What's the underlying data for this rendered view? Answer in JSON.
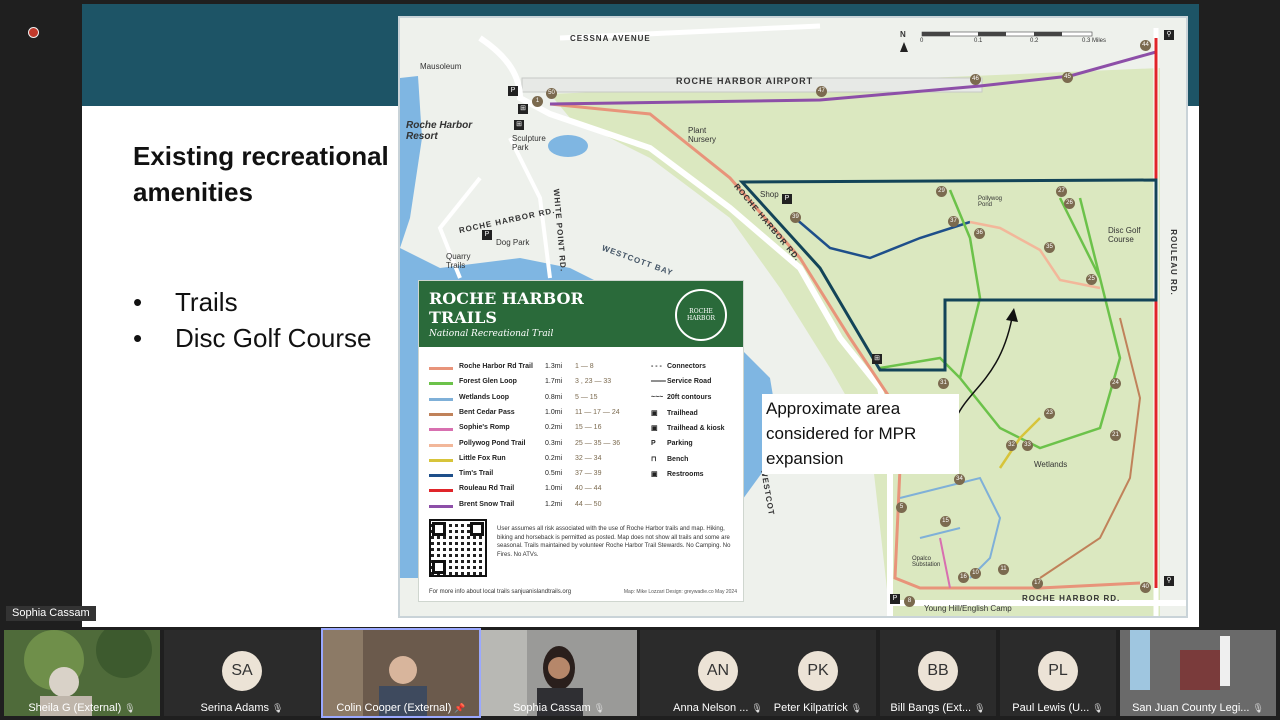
{
  "slide": {
    "title": "Existing recreational amenities",
    "bullets": [
      "Trails",
      "Disc Golf Course"
    ]
  },
  "map": {
    "labels": {
      "cessna": "CESSNA AVENUE",
      "airport": "ROCHE HARBOR AIRPORT",
      "mausoleum": "Mausoleum",
      "resort": "Roche Harbor Resort",
      "sculpture": "Sculpture Park",
      "nursery": "Plant Nursery",
      "shop": "Shop",
      "roche_rd_diag": "ROCHE HARBOR RD.",
      "roche_rd_west": "ROCHE HARBOR RD.",
      "white_point": "WHITE POINT RD.",
      "dog_park": "Dog Park",
      "quarry": "Quarry Trails",
      "westcott_bay": "WESTCOTT BAY",
      "westcott": "WESTCOT",
      "pollywog": "Pollywog Pond",
      "disc_golf": "Disc Golf Course",
      "rouleau": "ROULEAU RD.",
      "wetlands": "Wetlands",
      "opalco": "Opalco Substation",
      "roche_rd_south": "ROCHE HARBOR RD.",
      "young_hill": "Young Hill/English Camp",
      "north": "N",
      "scale": [
        "0",
        "0.1",
        "0.2",
        "0.3 Miles"
      ]
    },
    "pins": [
      "50",
      "1",
      "47",
      "46",
      "45",
      "44",
      "29",
      "27",
      "26",
      "39",
      "37",
      "36",
      "35",
      "25",
      "31",
      "24",
      "23",
      "32",
      "33",
      "21",
      "34",
      "5",
      "15",
      "16",
      "10",
      "11",
      "17",
      "40",
      "8"
    ],
    "annotation": "Approximate area considered for MPR expansion",
    "legend": {
      "title": "ROCHE HARBOR TRAILS",
      "subtitle": "National Recreational Trail",
      "seal": "ROCHE HARBOR",
      "trails": [
        {
          "name": "Roche Harbor Rd Trail",
          "length": "1.3mi",
          "pins": "1 — 8",
          "color": "#e8947a"
        },
        {
          "name": "Forest Glen Loop",
          "length": "1.7mi",
          "pins": "3 , 23 — 33",
          "color": "#6cc24a"
        },
        {
          "name": "Wetlands Loop",
          "length": "0.8mi",
          "pins": "5 — 15",
          "color": "#7fb0d8"
        },
        {
          "name": "Bent Cedar Pass",
          "length": "1.0mi",
          "pins": "11 — 17 — 24",
          "color": "#c0825a"
        },
        {
          "name": "Sophie's Romp",
          "length": "0.2mi",
          "pins": "15 — 16",
          "color": "#d870b0"
        },
        {
          "name": "Pollywog Pond Trail",
          "length": "0.3mi",
          "pins": "25 — 35 — 36",
          "color": "#f2b79a"
        },
        {
          "name": "Little Fox Run",
          "length": "0.2mi",
          "pins": "32 — 34",
          "color": "#d7c43a"
        },
        {
          "name": "Tim's Trail",
          "length": "0.5mi",
          "pins": "37 — 39",
          "color": "#1e4f8a"
        },
        {
          "name": "Rouleau Rd Trail",
          "length": "1.0mi",
          "pins": "40 — 44",
          "color": "#e0252a"
        },
        {
          "name": "Brent Snow Trail",
          "length": "1.2mi",
          "pins": "44 — 50",
          "color": "#8d4fa8"
        }
      ],
      "keys": [
        {
          "sym": "- - -",
          "label": "Connectors"
        },
        {
          "sym": "═══",
          "label": "Service Road"
        },
        {
          "sym": "~~~",
          "label": "20ft contours"
        },
        {
          "sym": "▣",
          "label": "Trailhead"
        },
        {
          "sym": "▣",
          "label": "Trailhead & kiosk"
        },
        {
          "sym": "P",
          "label": "Parking"
        },
        {
          "sym": "⊓",
          "label": "Bench"
        },
        {
          "sym": "▣",
          "label": "Restrooms"
        }
      ],
      "disclaimer": "User assumes all risk associated with the use of Roche Harbor trails and map. Hiking, biking and horseback is permitted as posted. Map does not show all trails and some are seasonal. Trails maintained by volunteer Roche Harbor Trail Stewards. No Camping. No Fires. No ATVs.",
      "footer": "For more info about local trails sanjuanislandtrails.org",
      "credit": "Map: Mike Lozzari Design: greywadie.co May 2024"
    }
  },
  "meeting": {
    "active_speaker": "Sophia Cassam",
    "participants": [
      {
        "name": "Sheila G (External)",
        "initials": "",
        "video": true
      },
      {
        "name": "Serina Adams",
        "initials": "SA",
        "video": false
      },
      {
        "name": "Colin Cooper (External)",
        "initials": "",
        "video": true
      },
      {
        "name": "Sophia Cassam",
        "initials": "",
        "video": true
      },
      {
        "name": "Anna Nelson ...",
        "initials": "AN",
        "video": false
      },
      {
        "name": "Peter Kilpatrick",
        "initials": "PK",
        "video": false
      },
      {
        "name": "Bill Bangs (Ext...",
        "initials": "BB",
        "video": false
      },
      {
        "name": "Paul Lewis (U...",
        "initials": "PL",
        "video": false
      },
      {
        "name": "San Juan County Legi...",
        "initials": "",
        "video": true
      }
    ]
  }
}
